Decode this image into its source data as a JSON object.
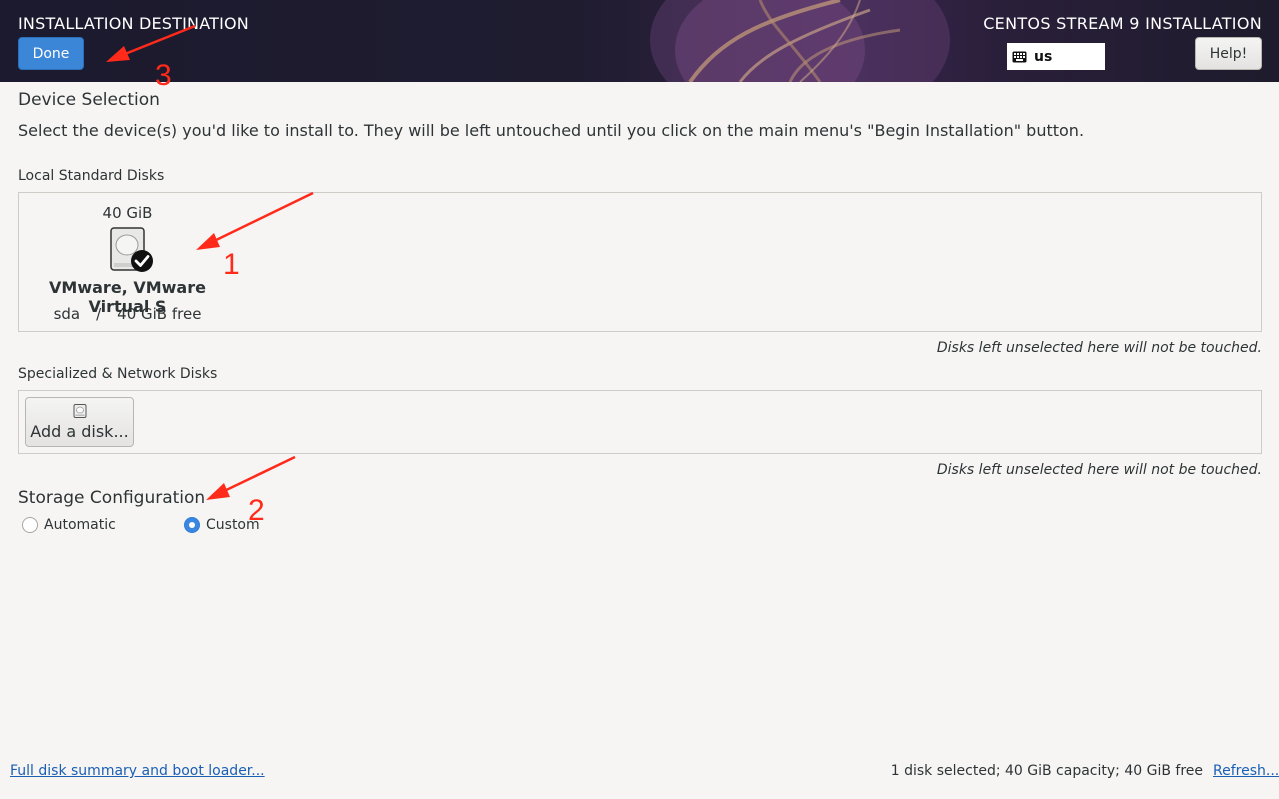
{
  "header": {
    "title": "INSTALLATION DESTINATION",
    "done_label": "Done",
    "product_title": "CENTOS STREAM 9 INSTALLATION",
    "keyboard_layout": "us",
    "help_label": "Help!"
  },
  "device_selection": {
    "title": "Device Selection",
    "description": "Select the device(s) you'd like to install to.  They will be left untouched until you click on the main menu's \"Begin Installation\" button."
  },
  "local_disks": {
    "title": "Local Standard Disks",
    "disks": [
      {
        "size": "40 GiB",
        "name": "VMware, VMware Virtual S",
        "device": "sda",
        "separator": "/",
        "free": "40 GiB free",
        "selected": true
      }
    ],
    "note": "Disks left unselected here will not be touched."
  },
  "network_disks": {
    "title": "Specialized & Network Disks",
    "add_disk_label": "Add a disk...",
    "note": "Disks left unselected here will not be touched."
  },
  "storage_config": {
    "title": "Storage Configuration",
    "options": [
      {
        "label": "Automatic",
        "checked": false
      },
      {
        "label": "Custom",
        "checked": true
      }
    ]
  },
  "footer": {
    "summary_link": "Full disk summary and boot loader...",
    "status": "1 disk selected; 40 GiB capacity; 40 GiB free",
    "refresh_link": "Refresh..."
  },
  "annotations": {
    "color": "#ff2a1a",
    "labels": [
      "1",
      "2",
      "3"
    ]
  },
  "colors": {
    "accent": "#3b86d6",
    "link": "#1a5fb4",
    "background": "#f6f5f4"
  }
}
